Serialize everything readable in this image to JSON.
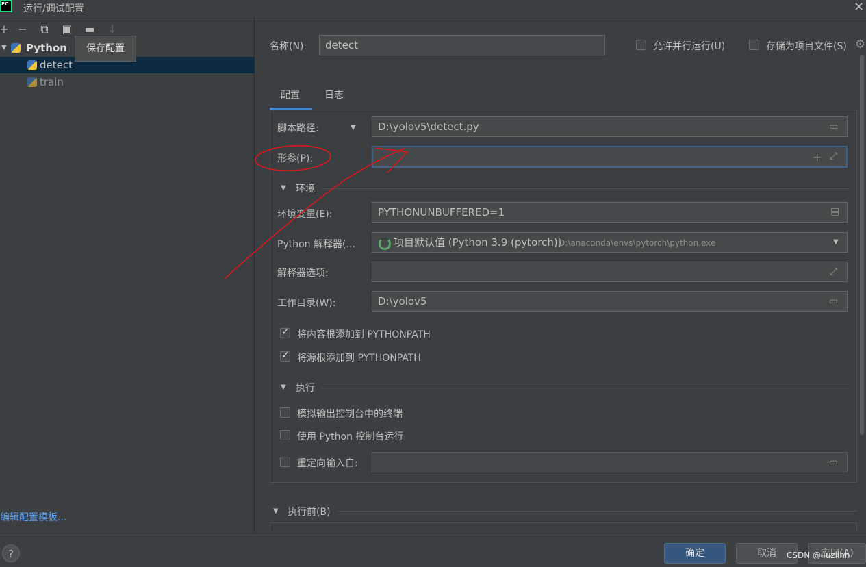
{
  "window": {
    "title": "运行/调试配置",
    "app_icon_text": "PC"
  },
  "toolbar": {
    "tooltip": "保存配置"
  },
  "tree": {
    "root": "Python",
    "items": [
      "detect",
      "train"
    ]
  },
  "left_footer": {
    "edit_templates_link": "编辑配置模板..."
  },
  "form": {
    "name_label": "名称(N):",
    "name_value": "detect",
    "allow_parallel": "允许并行运行(U)",
    "store_as_project_file": "存储为项目文件(S)",
    "tabs": [
      "配置",
      "日志"
    ],
    "script_path_label": "脚本路径:",
    "script_path_value": "D:\\yolov5\\detect.py",
    "params_label": "形参(P):",
    "params_value": "",
    "env_section": "环境",
    "env_vars_label": "环境变量(E):",
    "env_vars_value": "PYTHONUNBUFFERED=1",
    "interpreter_label": "Python 解释器(...",
    "interpreter_value": "项目默认值 (Python 3.9 (pytorch))",
    "interpreter_path": "D:\\anaconda\\envs\\pytorch\\python.exe",
    "interp_options_label": "解释器选项:",
    "interp_options_value": "",
    "working_dir_label": "工作目录(W):",
    "working_dir_value": "D:\\yolov5",
    "add_content_roots": "将内容根添加到 PYTHONPATH",
    "add_source_roots": "将源根添加到 PYTHONPATH",
    "exec_section": "执行",
    "emulate_terminal": "模拟输出控制台中的终端",
    "run_with_console": "使用 Python 控制台运行",
    "redirect_input": "重定向输入自:",
    "redirect_input_value": "",
    "before_launch": "执行前(B)"
  },
  "buttons": {
    "ok": "确定",
    "cancel": "取消",
    "apply": "应用(A)",
    "help": "?"
  },
  "watermark": "CSDN @liuzlihh"
}
